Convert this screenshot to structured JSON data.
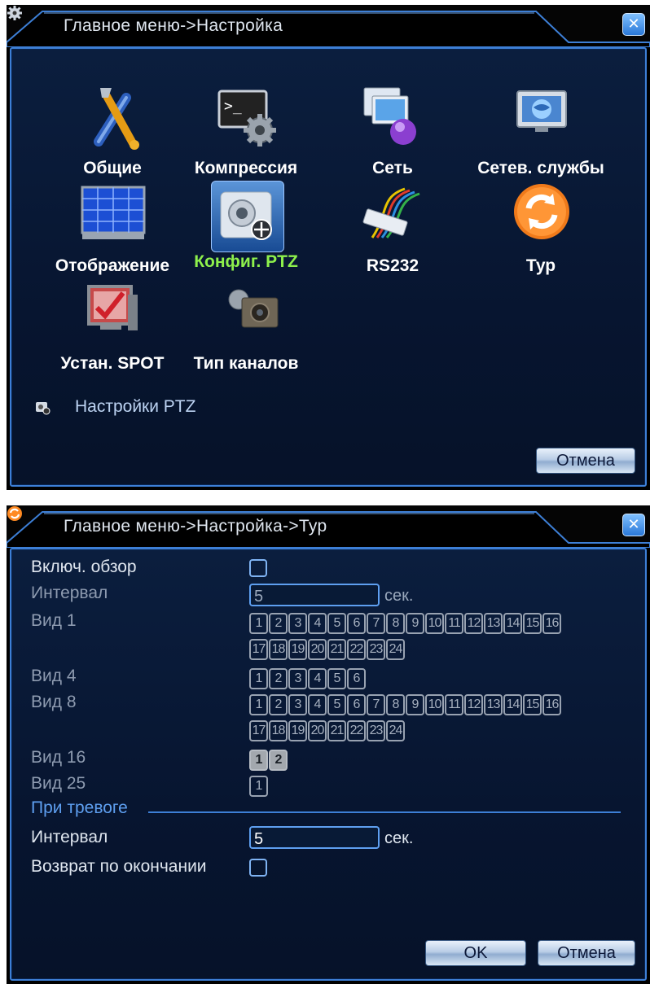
{
  "window1": {
    "title": "Главное меню->Настройка",
    "close_symbol": "✕",
    "title_icon": "gear-icon",
    "items": [
      {
        "label": "Общие",
        "icon": "wrench-screwdriver-icon"
      },
      {
        "label": "Компрессия",
        "icon": "terminal-gear-icon"
      },
      {
        "label": "Сеть",
        "icon": "network-screens-icon"
      },
      {
        "label": "Сетев. службы",
        "icon": "globe-monitor-icon"
      },
      {
        "label": "Отображение",
        "icon": "display-grid-icon"
      },
      {
        "label": "Конфиг. PTZ",
        "icon": "ptz-camera-icon",
        "selected": true
      },
      {
        "label": "RS232",
        "icon": "cable-connector-icon"
      },
      {
        "label": "Тур",
        "icon": "refresh-circle-icon"
      },
      {
        "label": "Устан. SPOT",
        "icon": "monitor-check-icon"
      },
      {
        "label": "Тип каналов",
        "icon": "camera-type-icon"
      }
    ],
    "hint": "Настройки PTZ",
    "cancel_label": "Отмена",
    "active_color": "#8ef04c"
  },
  "window2": {
    "title": "Главное меню->Настройка->Тур",
    "close_symbol": "✕",
    "title_icon": "refresh-circle-icon",
    "enable_label": "Включ. обзор",
    "interval_label": "Интервал",
    "interval_value": "5",
    "unit": "сек.",
    "view1_label": "Вид 1",
    "view4_label": "Вид 4",
    "view8_label": "Вид 8",
    "view16_label": "Вид 16",
    "view25_label": "Вид 25",
    "view1_channels": [
      "1",
      "2",
      "3",
      "4",
      "5",
      "6",
      "7",
      "8",
      "9",
      "10",
      "11",
      "12",
      "13",
      "14",
      "15",
      "16",
      "17",
      "18",
      "19",
      "20",
      "21",
      "22",
      "23",
      "24"
    ],
    "view4_channels": [
      "1",
      "2",
      "3",
      "4",
      "5",
      "6"
    ],
    "view8_channels": [
      "1",
      "2",
      "3",
      "4",
      "5",
      "6",
      "7",
      "8",
      "9",
      "10",
      "11",
      "12",
      "13",
      "14",
      "15",
      "16",
      "17",
      "18",
      "19",
      "20",
      "21",
      "22",
      "23",
      "24"
    ],
    "view16_channels": [
      "1",
      "2"
    ],
    "view25_channels": [
      "1"
    ],
    "alarm_section": "При тревоге",
    "alarm_interval_label": "Интервал",
    "alarm_interval_value": "5",
    "alarm_unit": "сек.",
    "return_label": "Возврат по окончании",
    "ok_label": "OK",
    "cancel_label": "Отмена"
  }
}
